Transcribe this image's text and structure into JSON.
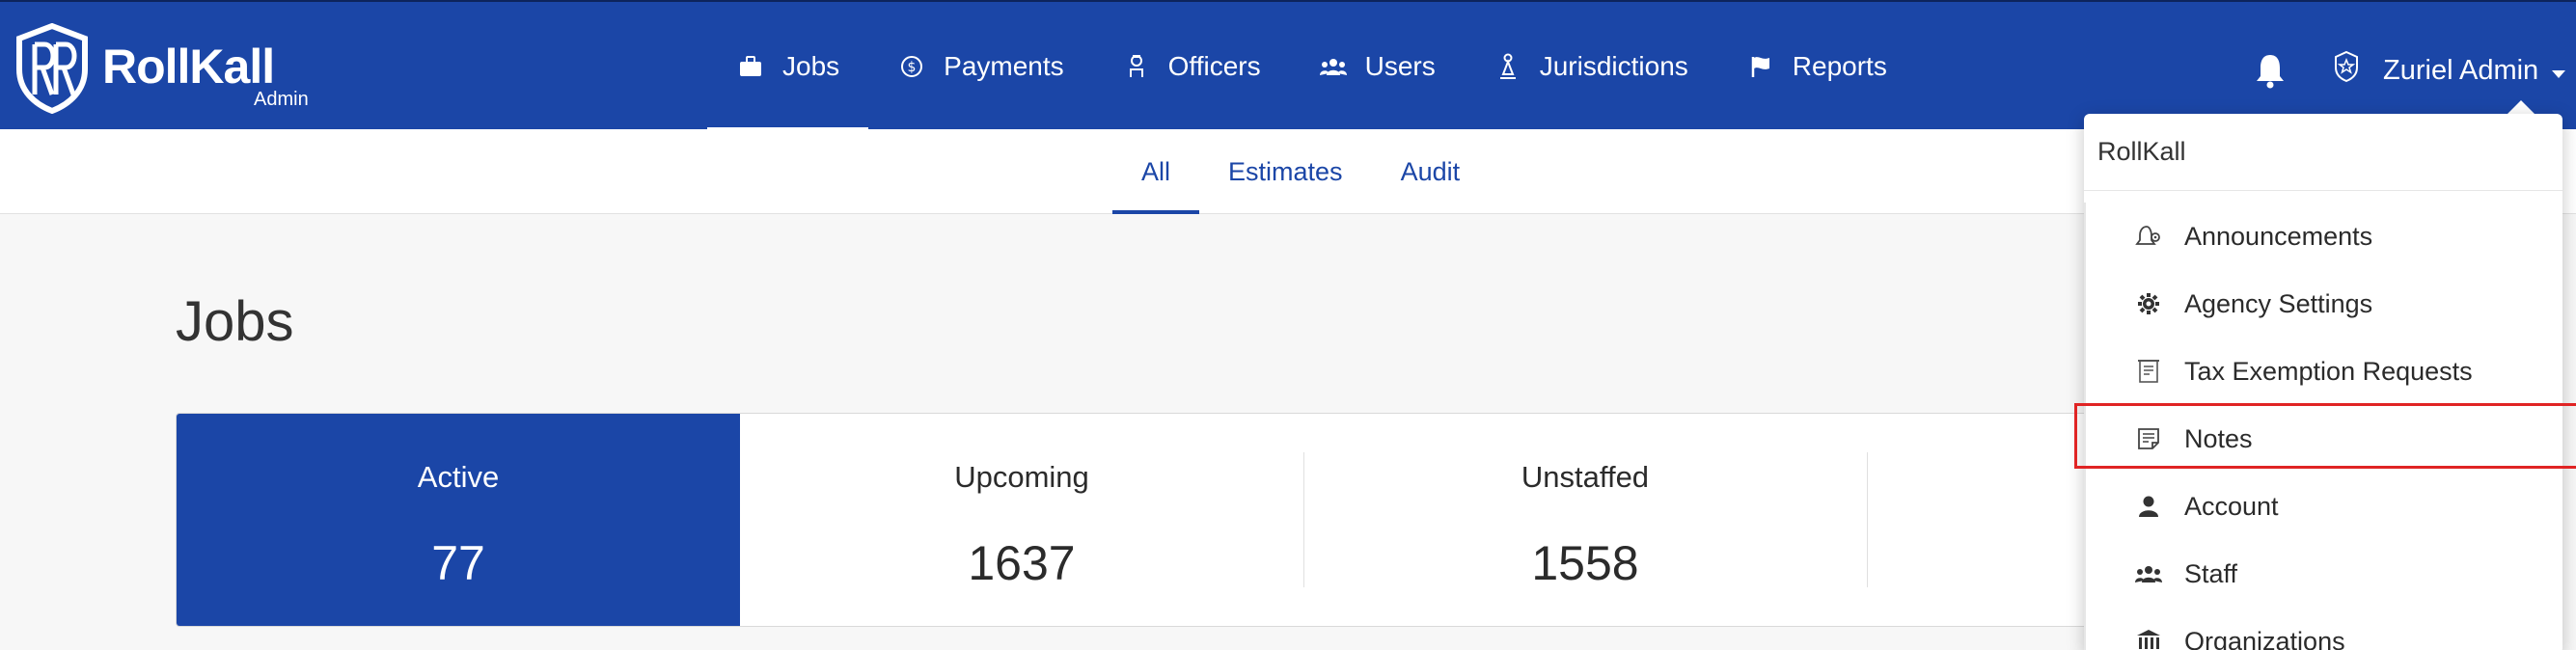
{
  "brand": {
    "name": "RollKall",
    "sub": "Admin",
    "color": "#1b46a7"
  },
  "nav": {
    "items": [
      {
        "label": "Jobs",
        "icon": "briefcase-icon",
        "active": true
      },
      {
        "label": "Payments",
        "icon": "dollar-circle-icon"
      },
      {
        "label": "Officers",
        "icon": "officer-icon"
      },
      {
        "label": "Users",
        "icon": "users-icon"
      },
      {
        "label": "Jurisdictions",
        "icon": "jurisdiction-icon"
      },
      {
        "label": "Reports",
        "icon": "flag-icon"
      }
    ]
  },
  "header": {
    "user_name": "Zuriel Admin"
  },
  "subnav": {
    "tabs": [
      {
        "label": "All",
        "active": true
      },
      {
        "label": "Estimates"
      },
      {
        "label": "Audit"
      }
    ]
  },
  "page": {
    "title": "Jobs"
  },
  "stats": [
    {
      "label": "Active",
      "value": "77",
      "active": true
    },
    {
      "label": "Upcoming",
      "value": "1637"
    },
    {
      "label": "Unstaffed",
      "value": "1558"
    },
    {
      "label": "",
      "value": ""
    }
  ],
  "dropdown": {
    "header": "RollKall",
    "items": [
      {
        "label": "Announcements",
        "icon": "announcement-bell-icon"
      },
      {
        "label": "Agency Settings",
        "icon": "gear-icon"
      },
      {
        "label": "Tax Exemption Requests",
        "icon": "receipt-icon"
      },
      {
        "label": "Notes",
        "icon": "note-icon",
        "highlighted": true
      },
      {
        "label": "Account",
        "icon": "person-icon"
      },
      {
        "label": "Staff",
        "icon": "users-icon"
      },
      {
        "label": "Organizations",
        "icon": "building-icon"
      }
    ]
  },
  "colors": {
    "primary": "#1b46a7",
    "highlight": "#e02424"
  }
}
